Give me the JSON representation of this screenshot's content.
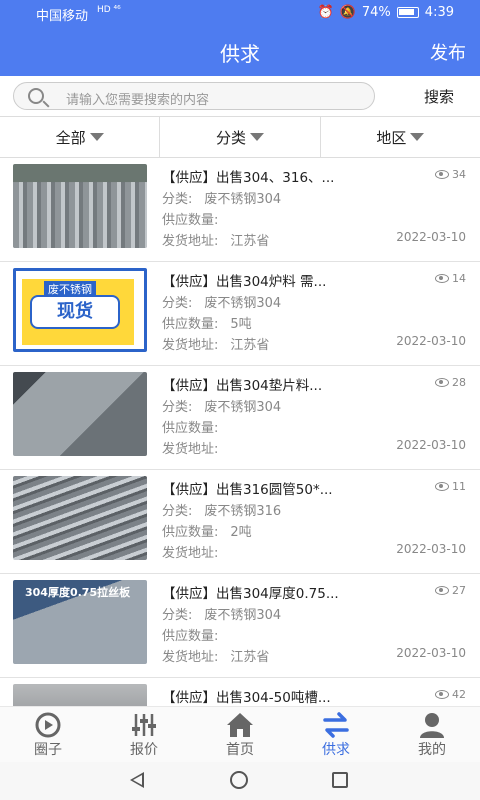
{
  "status": {
    "carrier": "中国移动",
    "net": "HD ⁴⁶",
    "battery": "74%",
    "time": "4:39"
  },
  "header": {
    "title": "供求",
    "publish_label": "发布"
  },
  "search": {
    "placeholder": "请输入您需要搜索的内容",
    "button_label": "搜索"
  },
  "filters": [
    {
      "label": "全部"
    },
    {
      "label": "分类"
    },
    {
      "label": "地区"
    }
  ],
  "field_labels": {
    "category": "分类:",
    "quantity": "供应数量:",
    "address": "发货地址:"
  },
  "items": [
    {
      "title": "【供应】出售304、316、...",
      "views": "34",
      "category": "废不锈钢304",
      "quantity": "",
      "address": "江苏省",
      "date": "2022-03-10",
      "thumb_caption": ""
    },
    {
      "title": "【供应】出售304炉料 需...",
      "views": "14",
      "category": "废不锈钢304",
      "quantity": "5吨",
      "address": "江苏省",
      "date": "2022-03-10",
      "thumb_caption": ""
    },
    {
      "title": "【供应】出售304垫片料...",
      "views": "28",
      "category": "废不锈钢304",
      "quantity": "",
      "address": "",
      "date": "2022-03-10",
      "thumb_caption": ""
    },
    {
      "title": "【供应】出售316圆管50*...",
      "views": "11",
      "category": "废不锈钢316",
      "quantity": "2吨",
      "address": "",
      "date": "2022-03-10",
      "thumb_caption": ""
    },
    {
      "title": "【供应】出售304厚度0.75...",
      "views": "27",
      "category": "废不锈钢304",
      "quantity": "",
      "address": "江苏省",
      "date": "2022-03-10",
      "thumb_caption": "304厚度0.75拉丝板"
    },
    {
      "title": "【供应】出售304-50吨槽...",
      "views": "42",
      "category": "",
      "quantity": "",
      "address": "",
      "date": "",
      "thumb_caption": ""
    }
  ],
  "thumb1": {
    "tag": "废不锈钢",
    "bubble": "现货"
  },
  "tabs": [
    {
      "label": "圈子",
      "icon": "circle-play-icon"
    },
    {
      "label": "报价",
      "icon": "sliders-icon"
    },
    {
      "label": "首页",
      "icon": "home-icon"
    },
    {
      "label": "供求",
      "icon": "swap-arrows-icon",
      "active": true
    },
    {
      "label": "我的",
      "icon": "user-icon"
    }
  ],
  "colors": {
    "primary": "#4e7cf0",
    "active_tab": "#3b6ee0"
  }
}
